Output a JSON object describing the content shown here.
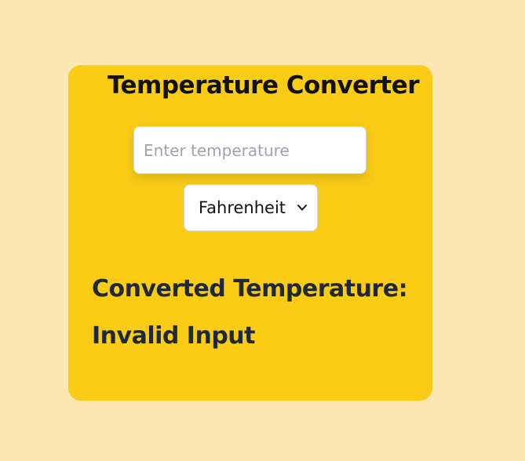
{
  "card": {
    "title": "Temperature Converter",
    "input": {
      "value": "",
      "placeholder": "Enter temperature"
    },
    "unit_select": {
      "selected": "Fahrenheit",
      "icon": "chevron-down-icon"
    },
    "result_label": "Converted Temperature:",
    "result_value": "Invalid Input"
  },
  "colors": {
    "page_background": "#fce7b2",
    "card_background": "#facc15",
    "title_text": "#111111",
    "result_text": "#1f2937",
    "placeholder_text": "#9ca3af"
  }
}
